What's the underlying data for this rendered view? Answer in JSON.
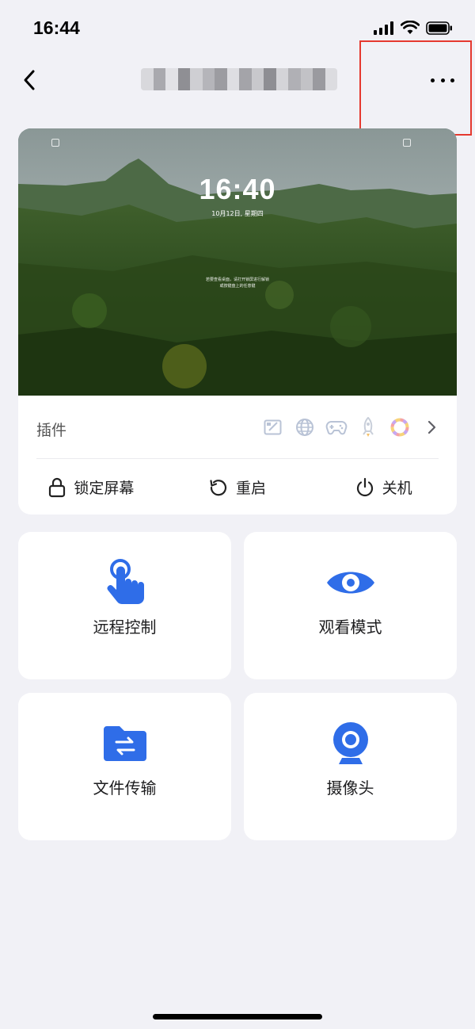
{
  "status_bar": {
    "time": "16:44"
  },
  "nav": {
    "title_blurred": true
  },
  "device": {
    "lock_screen": {
      "time": "16:40",
      "date": "10月12日, 星期四",
      "hint_line1": "若要查看桌面，请打开锁屏进行解锁",
      "hint_line2": "或按键盘上的任意键"
    },
    "plugins_label": "插件",
    "plugin_icons": [
      "whiteboard-icon",
      "globe-icon",
      "gamepad-icon",
      "rocket-icon",
      "colorful-ring-icon"
    ],
    "actions": [
      {
        "icon": "lock-icon",
        "label": "锁定屏幕"
      },
      {
        "icon": "restart-icon",
        "label": "重启"
      },
      {
        "icon": "power-icon",
        "label": "关机"
      }
    ]
  },
  "features": [
    {
      "icon": "hand-touch-icon",
      "label": "远程控制"
    },
    {
      "icon": "eye-icon",
      "label": "观看模式"
    },
    {
      "icon": "folder-transfer-icon",
      "label": "文件传输"
    },
    {
      "icon": "webcam-icon",
      "label": "摄像头"
    }
  ],
  "colors": {
    "accent": "#2f6de8",
    "background": "#f1f1f6",
    "highlight": "#e5392f"
  }
}
